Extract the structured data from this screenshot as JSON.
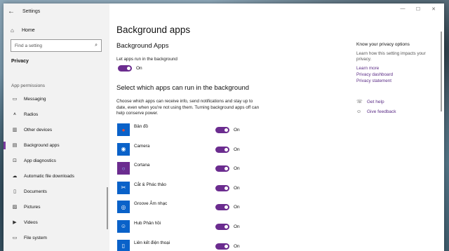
{
  "window": {
    "app_title": "Settings",
    "back": "←",
    "controls": {
      "minimize": "—",
      "maximize": "☐",
      "close": "✕"
    }
  },
  "sidebar": {
    "home": {
      "icon": "home-icon",
      "label": "Home"
    },
    "search": {
      "placeholder": "Find a setting",
      "icon": "search-icon"
    },
    "section": "Privacy",
    "group": "App permissions",
    "items": [
      {
        "label": "Messaging",
        "icon": "message-icon"
      },
      {
        "label": "Radios",
        "icon": "radio-tower-icon"
      },
      {
        "label": "Other devices",
        "icon": "devices-icon"
      },
      {
        "label": "Background apps",
        "icon": "background-apps-icon",
        "active": true
      },
      {
        "label": "App diagnostics",
        "icon": "diagnostics-icon"
      },
      {
        "label": "Automatic file downloads",
        "icon": "cloud-download-icon"
      },
      {
        "label": "Documents",
        "icon": "document-icon"
      },
      {
        "label": "Pictures",
        "icon": "picture-icon"
      },
      {
        "label": "Videos",
        "icon": "video-icon"
      },
      {
        "label": "File system",
        "icon": "file-system-icon"
      }
    ]
  },
  "main": {
    "title": "Background apps",
    "subtitle": "Background Apps",
    "toggle_label": "Let apps run in the background",
    "toggle_state": "On",
    "select_heading": "Select which apps can run in the background",
    "description": "Choose which apps can receive info, send notifications and stay up to date, even when you're not using them. Turning background apps off can help conserve power.",
    "apps": [
      {
        "name": "Bản đồ",
        "icon": "map-pin-icon",
        "glyph": "●",
        "state": "On"
      },
      {
        "name": "Camera",
        "icon": "camera-icon",
        "glyph": "◉",
        "state": "On"
      },
      {
        "name": "Cortana",
        "icon": "cortana-icon",
        "glyph": "○",
        "state": "On"
      },
      {
        "name": "Cắt & Phác thảo",
        "icon": "snip-sketch-icon",
        "glyph": "✂",
        "state": "On"
      },
      {
        "name": "Groove Âm nhạc",
        "icon": "groove-music-icon",
        "glyph": "◎",
        "state": "On"
      },
      {
        "name": "Hub Phản hồi",
        "icon": "feedback-hub-icon",
        "glyph": "☺",
        "state": "On"
      },
      {
        "name": "Liên kết điện thoại",
        "icon": "phone-link-icon",
        "glyph": "▯",
        "state": "On"
      }
    ]
  },
  "right_pane": {
    "title": "Know your privacy options",
    "description": "Learn how this setting impacts your privacy.",
    "links": [
      "Learn more",
      "Privacy dashboard",
      "Privacy statement"
    ],
    "help": {
      "label": "Get help",
      "icon": "help-chat-icon"
    },
    "feedback": {
      "label": "Give feedback",
      "icon": "feedback-icon"
    }
  },
  "colors": {
    "accent": "#6b2c8f",
    "link": "#5b2c86",
    "app_tile": "#0a62c9",
    "sidebar_bg": "#f2f2f2"
  }
}
